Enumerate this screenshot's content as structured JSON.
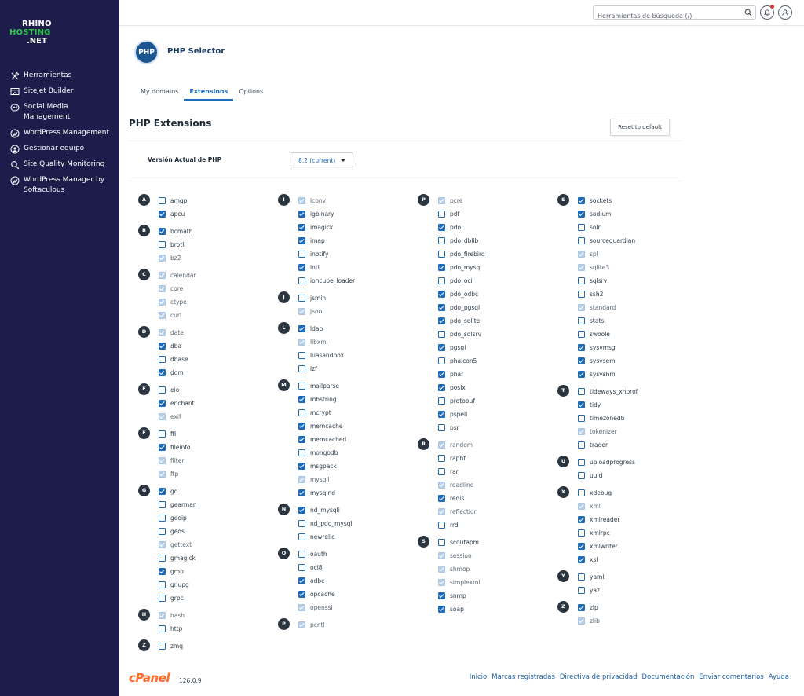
{
  "brand": {
    "line1": "RHINO",
    "line2": "HOSTING",
    "line3": ".NET"
  },
  "sidebar": {
    "items": [
      {
        "label": "Herramientas",
        "icon": "tools-icon"
      },
      {
        "label": "Sitejet Builder",
        "icon": "sitejet-icon"
      },
      {
        "label": "Social Media Management",
        "icon": "social-media-icon"
      },
      {
        "label": "WordPress Management",
        "icon": "wordpress-icon"
      },
      {
        "label": "Gestionar equipo",
        "icon": "team-icon"
      },
      {
        "label": "Site Quality Monitoring",
        "icon": "search-quality-icon"
      },
      {
        "label": "WordPress Manager by Softaculous",
        "icon": "wordpress-icon"
      }
    ]
  },
  "topbar": {
    "search_placeholder": "Herramientas de búsqueda (/)"
  },
  "header": {
    "badge": "PHP",
    "title": "PHP Selector"
  },
  "tabs": [
    "My domains",
    "Extensions",
    "Options"
  ],
  "section": {
    "title": "PHP Extensions",
    "reset_label": "Reset to default",
    "version_label": "Versión Actual de PHP",
    "version_value": "8.2 (current)"
  },
  "columns": [
    [
      {
        "letter": "A",
        "items": [
          [
            "amqp",
            "off"
          ],
          [
            "apcu",
            "on"
          ]
        ]
      },
      {
        "letter": "B",
        "items": [
          [
            "bcmath",
            "on"
          ],
          [
            "brotli",
            "off"
          ],
          [
            "bz2",
            "dis"
          ]
        ]
      },
      {
        "letter": "C",
        "items": [
          [
            "calendar",
            "dis"
          ],
          [
            "core",
            "dis"
          ],
          [
            "ctype",
            "dis"
          ],
          [
            "curl",
            "dis"
          ]
        ]
      },
      {
        "letter": "D",
        "items": [
          [
            "date",
            "dis"
          ],
          [
            "dba",
            "on"
          ],
          [
            "dbase",
            "off"
          ],
          [
            "dom",
            "on"
          ]
        ]
      },
      {
        "letter": "E",
        "items": [
          [
            "eio",
            "off"
          ],
          [
            "enchant",
            "on"
          ],
          [
            "exif",
            "dis"
          ]
        ]
      },
      {
        "letter": "F",
        "items": [
          [
            "ffi",
            "off"
          ],
          [
            "fileinfo",
            "on"
          ],
          [
            "filter",
            "dis"
          ],
          [
            "ftp",
            "dis"
          ]
        ]
      },
      {
        "letter": "G",
        "items": [
          [
            "gd",
            "on"
          ],
          [
            "gearman",
            "off"
          ],
          [
            "geoip",
            "off"
          ],
          [
            "geos",
            "off"
          ],
          [
            "gettext",
            "dis"
          ],
          [
            "gmagick",
            "off"
          ],
          [
            "gmp",
            "on"
          ],
          [
            "gnupg",
            "off"
          ],
          [
            "grpc",
            "off"
          ]
        ]
      },
      {
        "letter": "H",
        "items": [
          [
            "hash",
            "dis"
          ],
          [
            "http",
            "off"
          ]
        ]
      },
      {
        "letter": "Z",
        "items": [
          [
            "zmq",
            "off"
          ]
        ]
      }
    ],
    [
      {
        "letter": "I",
        "items": [
          [
            "iconv",
            "dis"
          ],
          [
            "igbinary",
            "on"
          ],
          [
            "imagick",
            "on"
          ],
          [
            "imap",
            "on"
          ],
          [
            "inotify",
            "off"
          ],
          [
            "intl",
            "on"
          ],
          [
            "ioncube_loader",
            "off"
          ]
        ]
      },
      {
        "letter": "J",
        "items": [
          [
            "jsmin",
            "off"
          ],
          [
            "json",
            "dis"
          ]
        ]
      },
      {
        "letter": "L",
        "items": [
          [
            "ldap",
            "on"
          ],
          [
            "libxml",
            "dis"
          ],
          [
            "luasandbox",
            "off"
          ],
          [
            "lzf",
            "off"
          ]
        ]
      },
      {
        "letter": "M",
        "items": [
          [
            "mailparse",
            "off"
          ],
          [
            "mbstring",
            "on"
          ],
          [
            "mcrypt",
            "off"
          ],
          [
            "memcache",
            "on"
          ],
          [
            "memcached",
            "on"
          ],
          [
            "mongodb",
            "off"
          ],
          [
            "msgpack",
            "on"
          ],
          [
            "mysqli",
            "dis"
          ],
          [
            "mysqlnd",
            "on"
          ]
        ]
      },
      {
        "letter": "N",
        "items": [
          [
            "nd_mysqli",
            "on"
          ],
          [
            "nd_pdo_mysql",
            "off"
          ],
          [
            "newrelic",
            "off"
          ]
        ]
      },
      {
        "letter": "O",
        "items": [
          [
            "oauth",
            "off"
          ],
          [
            "oci8",
            "off"
          ],
          [
            "odbc",
            "on"
          ],
          [
            "opcache",
            "on"
          ],
          [
            "openssl",
            "dis"
          ]
        ]
      },
      {
        "letter": "P",
        "items": [
          [
            "pcntl",
            "dis"
          ]
        ]
      }
    ],
    [
      {
        "letter": "P",
        "items": [
          [
            "pcre",
            "dis"
          ],
          [
            "pdf",
            "off"
          ],
          [
            "pdo",
            "on"
          ],
          [
            "pdo_dblib",
            "off"
          ],
          [
            "pdo_firebird",
            "off"
          ],
          [
            "pdo_mysql",
            "on"
          ],
          [
            "pdo_oci",
            "off"
          ],
          [
            "pdo_odbc",
            "on"
          ],
          [
            "pdo_pgsql",
            "on"
          ],
          [
            "pdo_sqlite",
            "on"
          ],
          [
            "pdo_sqlsrv",
            "off"
          ],
          [
            "pgsql",
            "on"
          ],
          [
            "phalcon5",
            "off"
          ],
          [
            "phar",
            "on"
          ],
          [
            "posix",
            "on"
          ],
          [
            "protobuf",
            "off"
          ],
          [
            "pspell",
            "on"
          ],
          [
            "psr",
            "off"
          ]
        ]
      },
      {
        "letter": "R",
        "items": [
          [
            "random",
            "dis"
          ],
          [
            "raphf",
            "off"
          ],
          [
            "rar",
            "off"
          ],
          [
            "readline",
            "dis"
          ],
          [
            "redis",
            "on"
          ],
          [
            "reflection",
            "dis"
          ],
          [
            "rrd",
            "off"
          ]
        ]
      },
      {
        "letter": "S",
        "items": [
          [
            "scoutapm",
            "off"
          ],
          [
            "session",
            "dis"
          ],
          [
            "shmop",
            "dis"
          ],
          [
            "simplexml",
            "dis"
          ],
          [
            "snmp",
            "on"
          ],
          [
            "soap",
            "on"
          ]
        ]
      }
    ],
    [
      {
        "letter": "S",
        "items": [
          [
            "sockets",
            "on"
          ],
          [
            "sodium",
            "on"
          ],
          [
            "solr",
            "off"
          ],
          [
            "sourceguardian",
            "off"
          ],
          [
            "spl",
            "dis"
          ],
          [
            "sqlite3",
            "dis"
          ],
          [
            "sqlsrv",
            "off"
          ],
          [
            "ssh2",
            "off"
          ],
          [
            "standard",
            "dis"
          ],
          [
            "stats",
            "off"
          ],
          [
            "swoole",
            "off"
          ],
          [
            "sysvmsg",
            "on"
          ],
          [
            "sysvsem",
            "on"
          ],
          [
            "sysvshm",
            "on"
          ]
        ]
      },
      {
        "letter": "T",
        "items": [
          [
            "tideways_xhprof",
            "off"
          ],
          [
            "tidy",
            "on"
          ],
          [
            "timezonedb",
            "off"
          ],
          [
            "tokenizer",
            "dis"
          ],
          [
            "trader",
            "off"
          ]
        ]
      },
      {
        "letter": "U",
        "items": [
          [
            "uploadprogress",
            "off"
          ],
          [
            "uuid",
            "off"
          ]
        ]
      },
      {
        "letter": "X",
        "items": [
          [
            "xdebug",
            "off"
          ],
          [
            "xml",
            "dis"
          ],
          [
            "xmlreader",
            "on"
          ],
          [
            "xmlrpc",
            "off"
          ],
          [
            "xmlwriter",
            "on"
          ],
          [
            "xsl",
            "on"
          ]
        ]
      },
      {
        "letter": "Y",
        "items": [
          [
            "yaml",
            "off"
          ],
          [
            "yaz",
            "off"
          ]
        ]
      },
      {
        "letter": "Z",
        "items": [
          [
            "zip",
            "on"
          ],
          [
            "zlib",
            "dis"
          ]
        ]
      }
    ]
  ],
  "footer": {
    "logo": "cPanel",
    "version": "126.0.9",
    "links": [
      "Inicio",
      "Marcas registradas",
      "Directiva de privacidad",
      "Documentación",
      "Enviar comentarios",
      "Ayuda"
    ]
  },
  "colors": {
    "sidebar": "#1c1d4a",
    "accent": "#1f6cbb",
    "brand_green": "#2ec44a",
    "cpanel_orange": "#ff6c2c"
  }
}
